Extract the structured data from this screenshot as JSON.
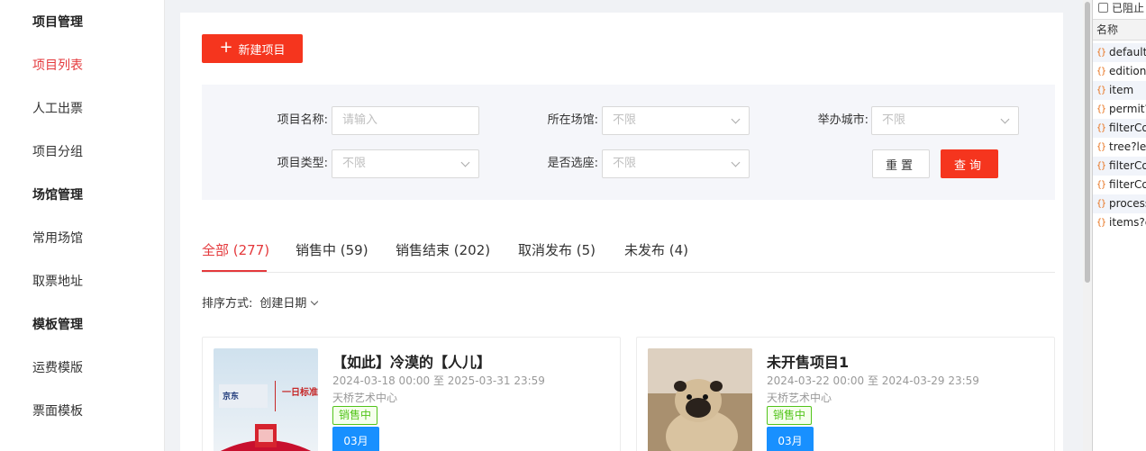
{
  "sidebar": {
    "items": [
      {
        "label": "项目管理",
        "type": "group"
      },
      {
        "label": "项目列表",
        "type": "active"
      },
      {
        "label": "人工出票",
        "type": "item"
      },
      {
        "label": "项目分组",
        "type": "item"
      },
      {
        "label": "场馆管理",
        "type": "group"
      },
      {
        "label": "常用场馆",
        "type": "item"
      },
      {
        "label": "取票地址",
        "type": "item"
      },
      {
        "label": "模板管理",
        "type": "group"
      },
      {
        "label": "运费模版",
        "type": "item"
      },
      {
        "label": "票面模板",
        "type": "item"
      }
    ]
  },
  "toolbar": {
    "new_project_label": "新建项目",
    "plus_icon": "+"
  },
  "filter": {
    "name_label": "项目名称:",
    "name_placeholder": "请输入",
    "venue_label": "所在场馆:",
    "venue_value": "不限",
    "city_label": "举办城市:",
    "city_value": "不限",
    "type_label": "项目类型:",
    "type_value": "不限",
    "seat_label": "是否选座:",
    "seat_value": "不限",
    "reset_label": "重置",
    "query_label": "查询"
  },
  "tabs": [
    {
      "label": "全部 (277)",
      "active": true
    },
    {
      "label": "销售中 (59)",
      "active": false
    },
    {
      "label": "销售结束 (202)",
      "active": false
    },
    {
      "label": "取消发布 (5)",
      "active": false
    },
    {
      "label": "未发布 (4)",
      "active": false
    }
  ],
  "sort": {
    "label": "排序方式:",
    "value": "创建日期"
  },
  "cards": [
    {
      "title": "【如此】冷漠的【人儿】",
      "date_range": "2024-03-18 00:00 至 2025-03-31 23:59",
      "venue": "天桥艺术中心",
      "status": "销售中",
      "month": "03月",
      "poster_text": "一日标准票"
    },
    {
      "title": "未开售项目1",
      "date_range": "2024-03-22 00:00 至 2024-03-29 23:59",
      "venue": "天桥艺术中心",
      "status": "销售中",
      "month": "03月"
    }
  ],
  "devtools": {
    "blocked_label": "已阻止",
    "name_header": "名称",
    "requests": [
      "default",
      "edition",
      "item",
      "permit?",
      "filterCo",
      "tree?lev",
      "filterCo",
      "filterCo",
      "process",
      "items?c"
    ]
  },
  "colors": {
    "accent": "#f5351e",
    "active_text": "#e4393c",
    "status_green": "#52c41a",
    "month_blue": "#1890ff"
  }
}
